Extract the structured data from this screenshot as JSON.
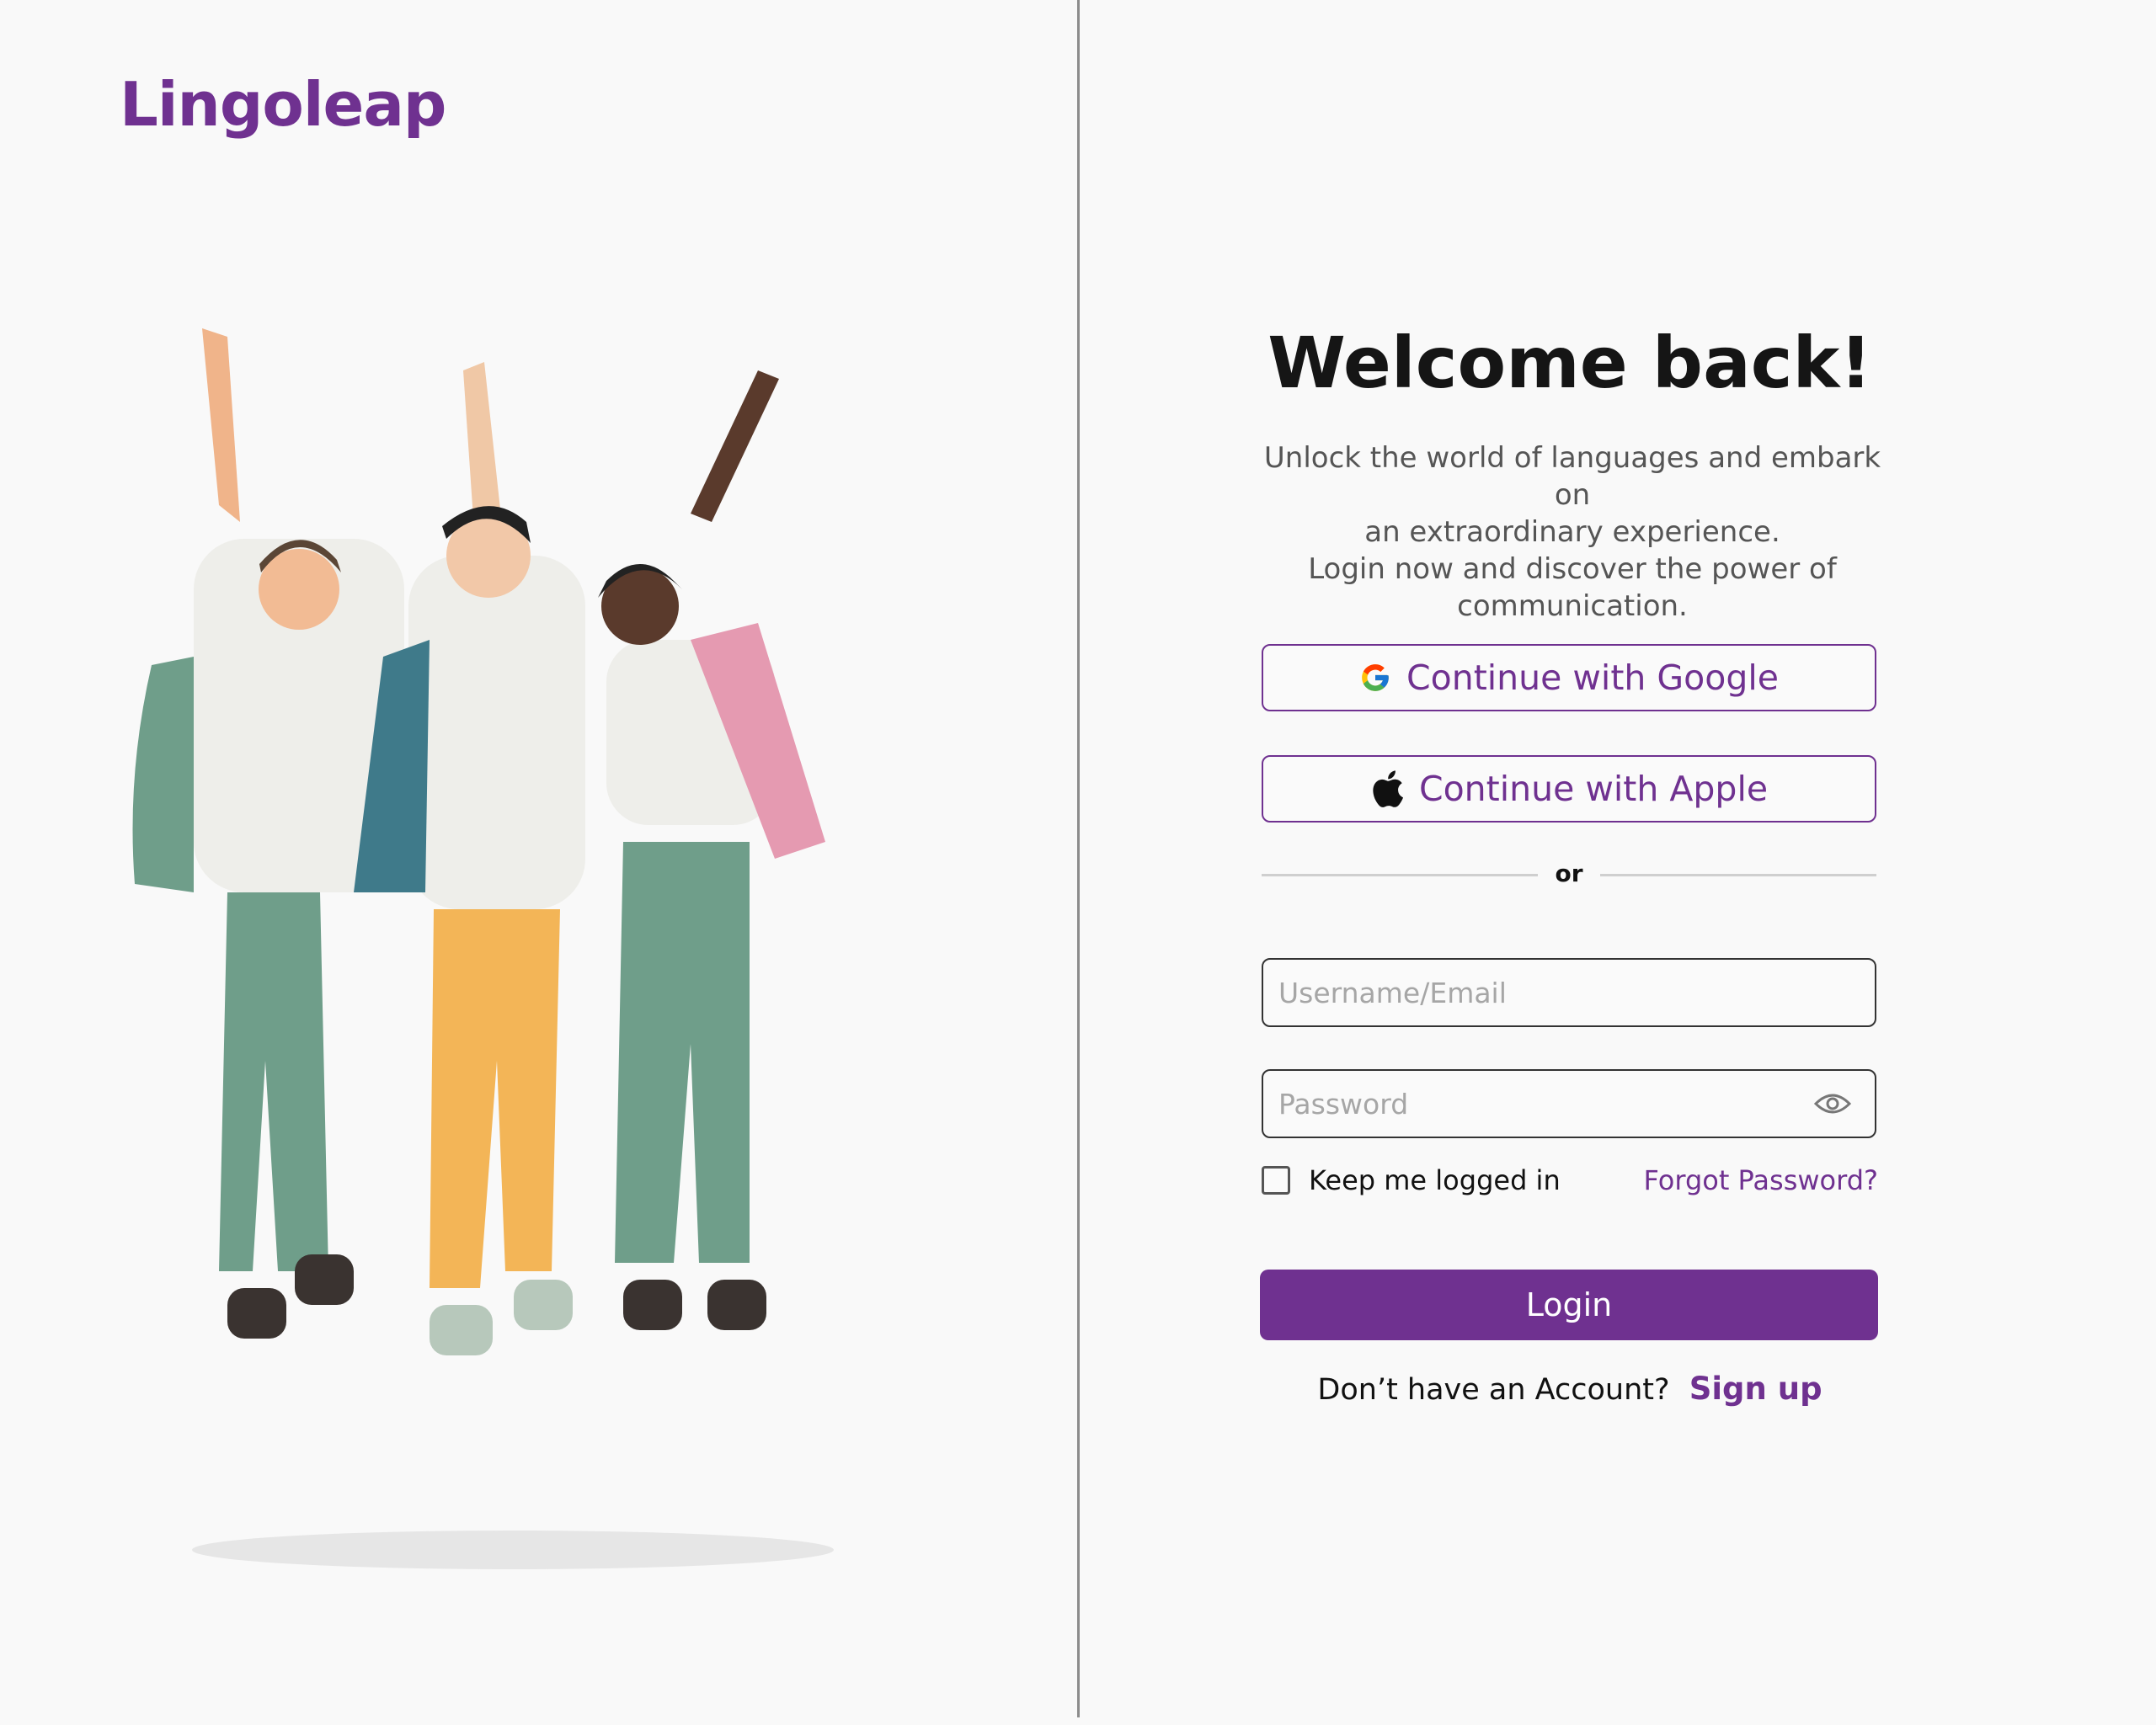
{
  "brand": {
    "logo_text": "Lingoleap",
    "accent_color": "#6f3190"
  },
  "login": {
    "title": "Welcome back!",
    "subtitle_lines": [
      "Unlock the world of languages and embark on",
      "an extraordinary experience.",
      "Login now and discover the power of",
      "communication."
    ],
    "google_label": "Continue with Google",
    "apple_label": "Continue with Apple",
    "or_text": "or",
    "username_placeholder": "Username/Email",
    "password_placeholder": "Password",
    "keep_logged_label": "Keep me logged in",
    "keep_logged_checked": false,
    "forgot_label": "Forgot Password?",
    "login_label": "Login",
    "no_account_text": "Don’t have an Account?",
    "signup_label": "Sign up"
  },
  "icons": {
    "google": "google-icon",
    "apple": "apple-icon",
    "eye": "eye-icon"
  }
}
